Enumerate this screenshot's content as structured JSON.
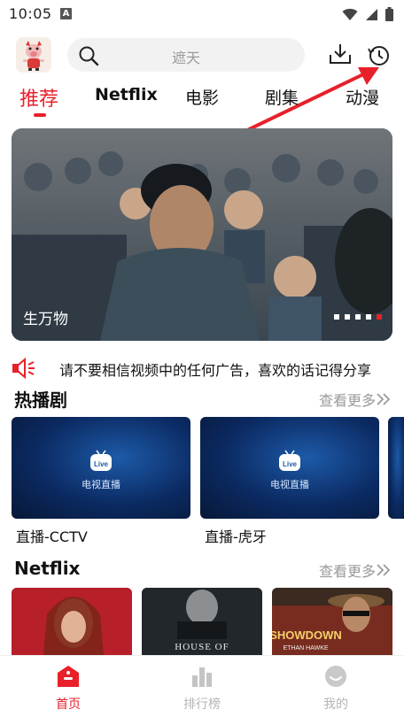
{
  "status_bar": {
    "time": "10:05",
    "notif_letter": "A"
  },
  "header": {
    "search_placeholder": "遮天"
  },
  "tabs": [
    {
      "label": "推荐",
      "active": true
    },
    {
      "label": "Netflix"
    },
    {
      "label": "电影"
    },
    {
      "label": "剧集"
    },
    {
      "label": "动漫"
    }
  ],
  "banner": {
    "title": "生万物",
    "dot_count": 5,
    "active_dot": 4
  },
  "notice": {
    "text": "请不要相信视频中的任何广告，喜欢的话记得分享"
  },
  "sections": {
    "hot": {
      "title": "热播剧",
      "more": "查看更多"
    },
    "netflix": {
      "title": "Netflix",
      "more": "查看更多"
    }
  },
  "hot_cards": [
    {
      "caption": "直播-CCTV",
      "logo_text": "电视直播",
      "badge": "Live"
    },
    {
      "caption": "直播-虎牙",
      "logo_text": "电视直播",
      "badge": "Live"
    }
  ],
  "netflix_posters": [
    {
      "text": ""
    },
    {
      "text": "HOUSE OF"
    },
    {
      "text": "SHOWDOWN",
      "sub": "ETHAN HAWKE"
    }
  ],
  "bottom_nav": [
    {
      "label": "首页",
      "active": true
    },
    {
      "label": "排行榜"
    },
    {
      "label": "我的"
    }
  ],
  "colors": {
    "accent": "#e8202a",
    "inactive": "#b5b5b5"
  }
}
